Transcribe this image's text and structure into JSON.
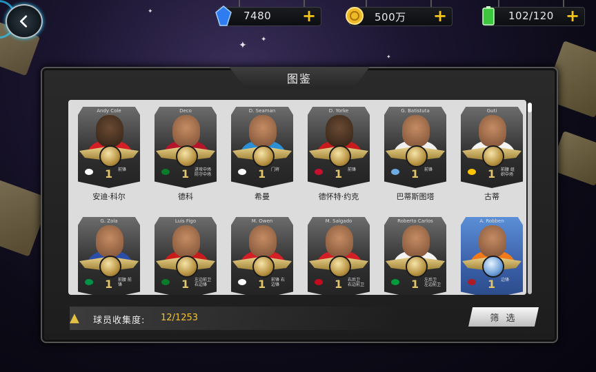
{
  "resources": {
    "gems": "7480",
    "coins": "500万",
    "energy": "102/120"
  },
  "panel": {
    "title": "图鉴",
    "collection_label": "球员收集度:",
    "collection_value": "12/1253",
    "filter_label": "筛 选"
  },
  "cards": [
    {
      "tag": "Andy Cole",
      "name": "安迪·科尔",
      "level": "1",
      "pos": "前锋",
      "flag": "#ffffff"
    },
    {
      "tag": "Deco",
      "name": "德科",
      "level": "1",
      "pos": "进攻中场 防守中场",
      "flag": "#0a7a2b"
    },
    {
      "tag": "D. Seaman",
      "name": "希曼",
      "level": "1",
      "pos": "门将",
      "flag": "#ffffff"
    },
    {
      "tag": "D. Yorke",
      "name": "德怀特·约克",
      "level": "1",
      "pos": "前锋",
      "flag": "#c8102e"
    },
    {
      "tag": "G. Batistuta",
      "name": "巴蒂斯图塔",
      "level": "1",
      "pos": "前锋",
      "flag": "#6cace4"
    },
    {
      "tag": "Guti",
      "name": "古蒂",
      "level": "1",
      "pos": "前腰 组织中场",
      "flag": "#ffc400"
    },
    {
      "tag": "G. Zola",
      "name": "",
      "level": "1",
      "pos": "前腰 前锋",
      "flag": "#009246"
    },
    {
      "tag": "Luis Figo",
      "name": "",
      "level": "1",
      "pos": "左边前卫 右边锋",
      "flag": "#0a7a2b"
    },
    {
      "tag": "M. Owen",
      "name": "",
      "level": "1",
      "pos": "前锋 右边锋",
      "flag": "#ffffff"
    },
    {
      "tag": "M. Salgado",
      "name": "",
      "level": "1",
      "pos": "右后卫 右边前卫",
      "flag": "#c60b1e"
    },
    {
      "tag": "Roberto Carlos",
      "name": "",
      "level": "1",
      "pos": "左后卫 左边前卫",
      "flag": "#009c3b"
    },
    {
      "tag": "A. Robben",
      "name": "",
      "level": "1",
      "pos": "边锋",
      "flag": "#ae1c28"
    }
  ]
}
